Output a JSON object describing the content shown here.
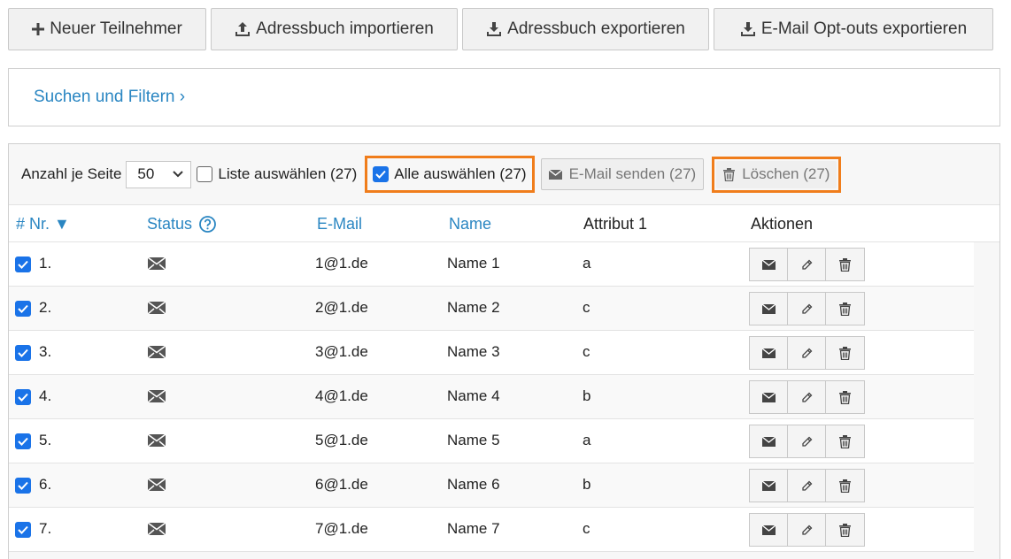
{
  "toolbar": {
    "buttons": [
      {
        "label": "Neuer Teilnehmer",
        "icon": "plus-icon"
      },
      {
        "label": "Adressbuch importieren",
        "icon": "upload-icon"
      },
      {
        "label": "Adressbuch exportieren",
        "icon": "download-icon"
      },
      {
        "label": "E-Mail Opt-outs exportieren",
        "icon": "download-icon"
      }
    ]
  },
  "filter": {
    "label": "Suchen und Filtern ›"
  },
  "controls": {
    "per_page_label": "Anzahl je Seite",
    "per_page_value": "50",
    "select_list_label": "Liste auswählen (27)",
    "select_list_checked": false,
    "select_all_label": "Alle auswählen (27)",
    "select_all_checked": true,
    "send_email_label": "E-Mail senden (27)",
    "delete_label": "Löschen (27)"
  },
  "table": {
    "headers": {
      "nr": "# Nr. ▼",
      "status": "Status",
      "email": "E-Mail",
      "name": "Name",
      "attr1": "Attribut 1",
      "actions": "Aktionen"
    },
    "rows": [
      {
        "nr": "1.",
        "email": "1@1.de",
        "name": "Name 1",
        "attr": "a",
        "checked": true
      },
      {
        "nr": "2.",
        "email": "2@1.de",
        "name": "Name 2",
        "attr": "c",
        "checked": true
      },
      {
        "nr": "3.",
        "email": "3@1.de",
        "name": "Name 3",
        "attr": "c",
        "checked": true
      },
      {
        "nr": "4.",
        "email": "4@1.de",
        "name": "Name 4",
        "attr": "b",
        "checked": true
      },
      {
        "nr": "5.",
        "email": "5@1.de",
        "name": "Name 5",
        "attr": "a",
        "checked": true
      },
      {
        "nr": "6.",
        "email": "6@1.de",
        "name": "Name 6",
        "attr": "b",
        "checked": true
      },
      {
        "nr": "7.",
        "email": "7@1.de",
        "name": "Name 7",
        "attr": "c",
        "checked": true
      }
    ]
  },
  "colors": {
    "link": "#2a86c2",
    "highlight": "#f07d1b",
    "checkbox": "#1a73e8"
  }
}
